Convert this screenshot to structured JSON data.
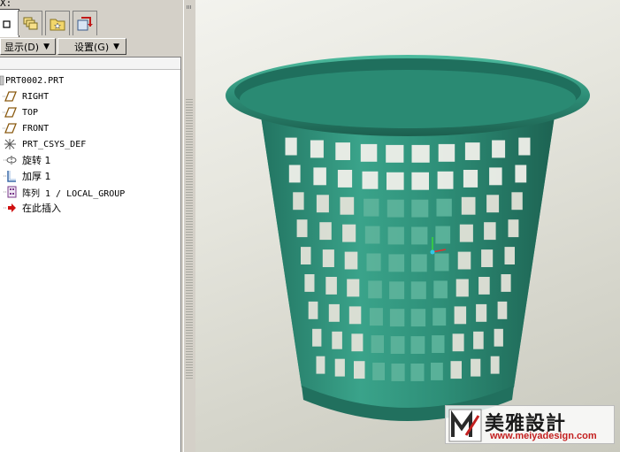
{
  "window": {
    "title_fragment": "X:"
  },
  "tabs": [
    {
      "icon": "blank-page-icon",
      "active": true
    },
    {
      "icon": "layers-icon",
      "active": false
    },
    {
      "icon": "folder-star-icon",
      "active": false
    },
    {
      "icon": "tools-red-arrow-icon",
      "active": false
    }
  ],
  "menu": {
    "display_label": "显示(D)",
    "settings_label": "设置(G)"
  },
  "model_tree": {
    "items": [
      {
        "label": "PRT0002.PRT",
        "icon": "part-file-icon"
      },
      {
        "label": "RIGHT",
        "icon": "datum-plane-icon"
      },
      {
        "label": "TOP",
        "icon": "datum-plane-icon"
      },
      {
        "label": "FRONT",
        "icon": "datum-plane-icon"
      },
      {
        "label": "PRT_CSYS_DEF",
        "icon": "coordinate-system-icon"
      },
      {
        "label": "旋转 1",
        "icon": "revolve-icon"
      },
      {
        "label": "加厚 1",
        "icon": "thicken-icon"
      },
      {
        "label": "阵列 1 / LOCAL_GROUP",
        "icon": "pattern-icon"
      },
      {
        "label": "在此插入",
        "icon": "insert-here-arrow-icon"
      }
    ]
  },
  "viewport": {
    "object": "green-mesh-basket-3d-model",
    "background_color": "#e4e4dc",
    "model_color": "#2e8f78"
  },
  "watermark": {
    "brand_cn": "美雅設計",
    "url": "www.meiyadesign.com"
  },
  "colors": {
    "panel": "#d4d0c8",
    "tree_bg": "#ffffff",
    "accent_arrow": "#1b3f9a",
    "watermark_url": "#c42020"
  }
}
